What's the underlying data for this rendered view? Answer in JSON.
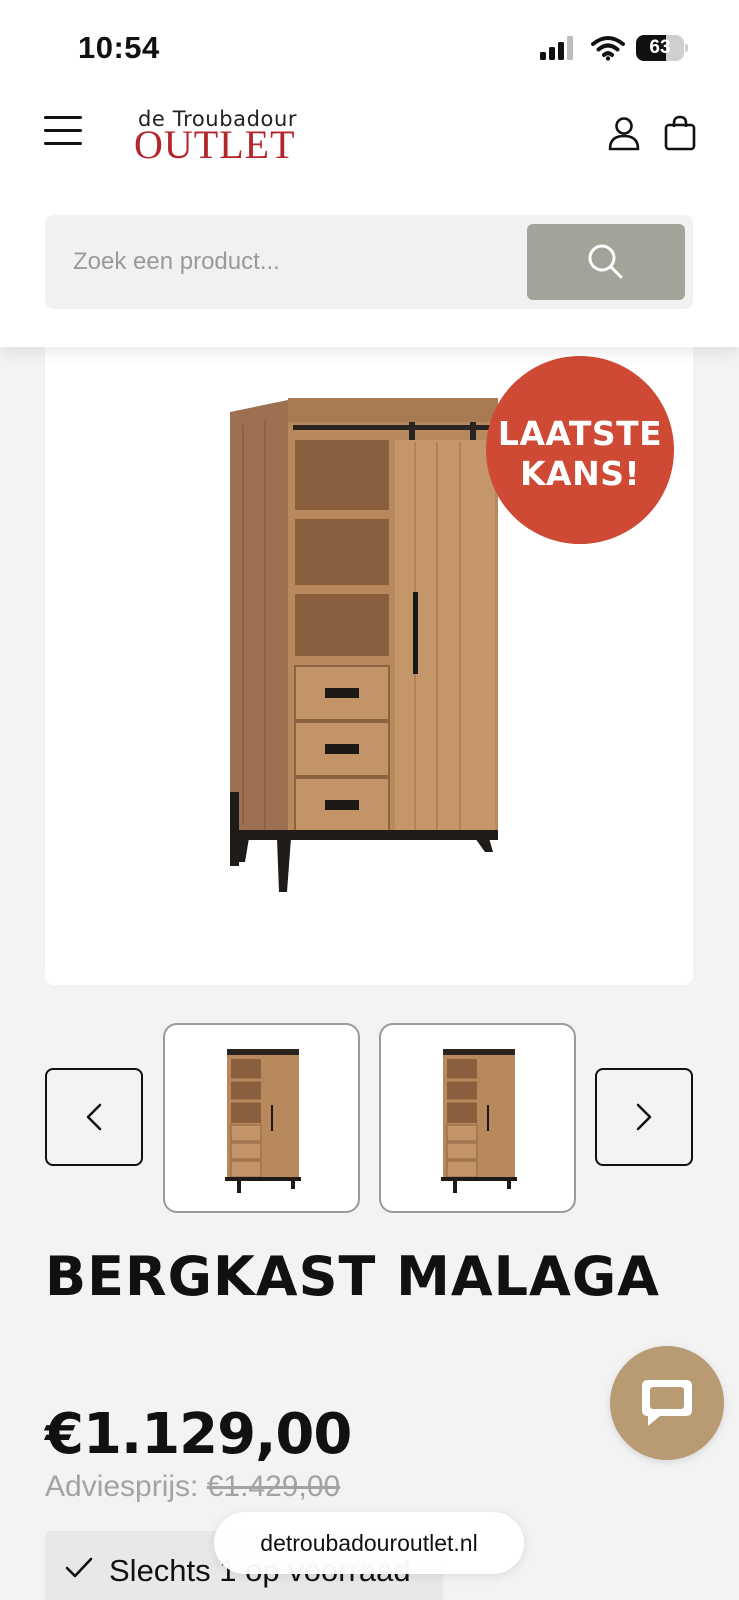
{
  "status_bar": {
    "time": "10:54",
    "battery": "63",
    "battery_level": 0.63
  },
  "header": {
    "logo_small": "de Troubadour",
    "logo_big": "OUTLET",
    "search": {
      "placeholder": "Zoek een product..."
    }
  },
  "product": {
    "badge_line1": "LAATSTE",
    "badge_line2": "KANS!",
    "title": "BERGKAST MALAGA",
    "price": "€1.129,00",
    "advice_label": "Adviesprijs:",
    "advice_price": "€1.429,00",
    "stock": "Slechts 1 op voorraad"
  },
  "browser": {
    "url": "detroubadouroutlet.nl"
  },
  "colors": {
    "brand_red": "#b3262b",
    "badge": "#cf4a35",
    "search_button": "#a3a399",
    "chat": "#b89a73"
  }
}
